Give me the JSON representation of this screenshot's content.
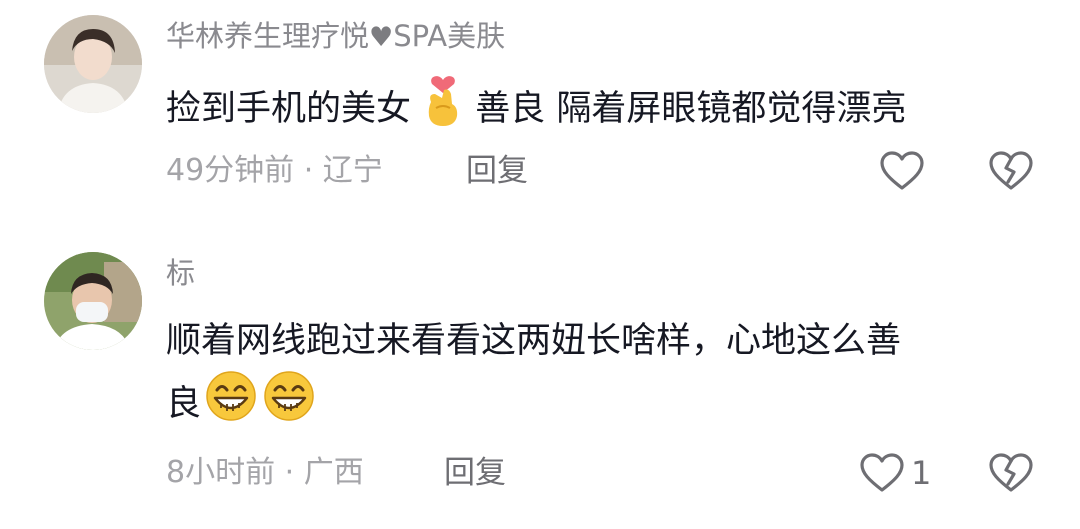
{
  "comments": [
    {
      "username_pre": "华林养生理疗悦",
      "username_post": "SPA美肤",
      "text_a": "捡到手机的美女",
      "text_b": "善良  隔着屏眼镜都觉得漂亮",
      "time_location": "49分钟前 · 辽宁",
      "reply_label": "回复",
      "like_count": "",
      "icons": [
        "heart-icon",
        "heart-finger-emoji",
        "like-heart-icon",
        "broken-heart-icon"
      ]
    },
    {
      "username": "标",
      "text_line1": "顺着网线跑过来看看这两妞长啥样，心地这么善",
      "text_line2": "良",
      "time_location": "8小时前 · 广西",
      "reply_label": "回复",
      "like_count": "1",
      "icons": [
        "grin-emoji",
        "like-heart-icon",
        "broken-heart-icon"
      ]
    }
  ],
  "colors": {
    "text": "#161823",
    "username": "#8a8a8f",
    "meta": "#a4a4a8",
    "action": "#6e6e73"
  }
}
